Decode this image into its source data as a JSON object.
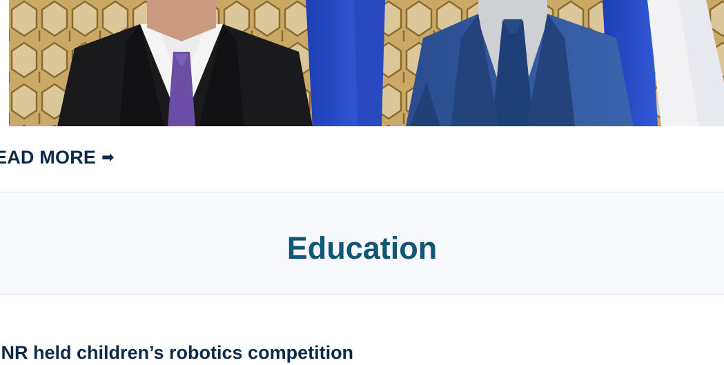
{
  "hero": {
    "link_label": "EAD MORE",
    "arrow_glyph": "➡"
  },
  "section": {
    "title": "Education"
  },
  "article": {
    "title": "INR held children’s robotics competition"
  },
  "colors": {
    "link": "#0b2a4a",
    "section_title": "#0f5677",
    "banner_bg": "#f7f9fc"
  }
}
